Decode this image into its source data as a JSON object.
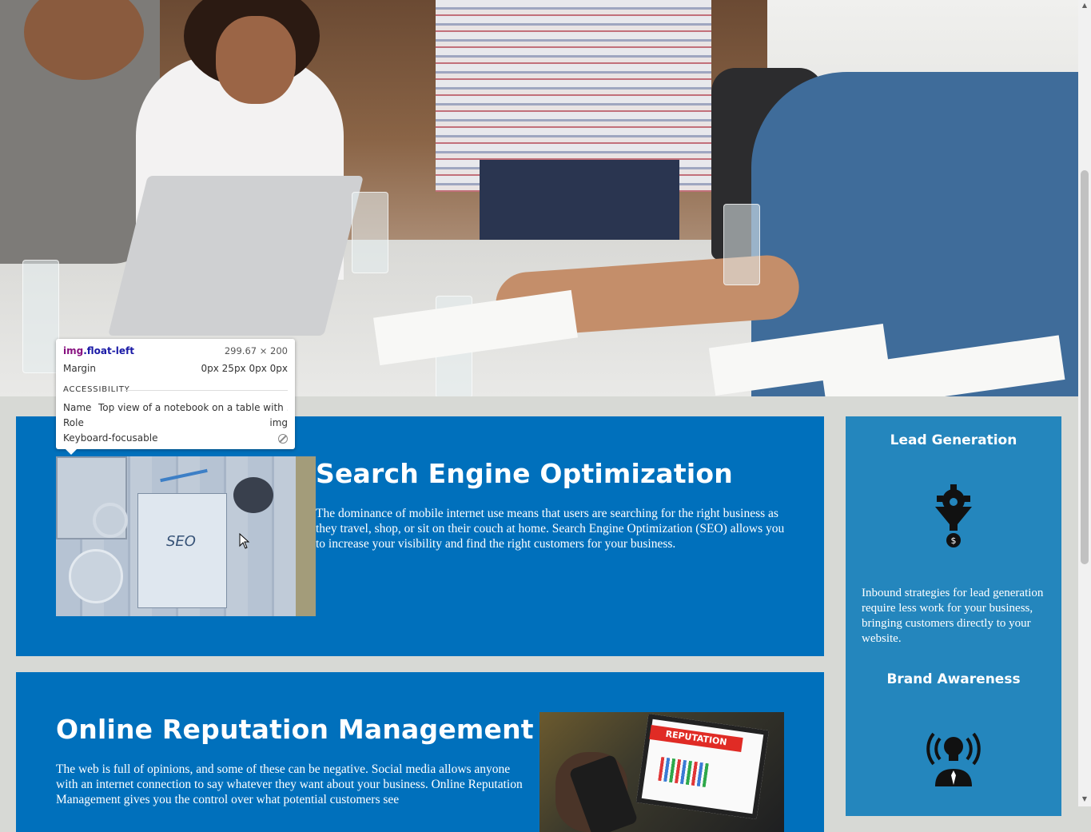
{
  "hero": {
    "image_alt": "Team meeting photo with people around a table"
  },
  "seo_card": {
    "title": "Search Engine Optimization",
    "body": "The dominance of mobile internet use means that users are searching for the right business as they travel, shop, or sit on their couch at home. Search Engine Optimization (SEO) allows you to increase your visibility and find the right customers for your business.",
    "image_word": "SEO"
  },
  "orm_card": {
    "title": "Online Reputation Management",
    "body": "The web is full of opinions, and some of these can be negative. Social media allows anyone with an internet connection to say whatever they want about your business. Online Reputation Management gives you the control over what potential customers see",
    "image_banner": "REPUTATION"
  },
  "sidebar": {
    "lead_title": "Lead Generation",
    "lead_body": "Inbound strategies for lead generation require less work for your business, bringing customers directly to your website.",
    "brand_title": "Brand Awareness"
  },
  "tooltip": {
    "tag": "img",
    "cls": ".float-left",
    "size": "299.67 × 200",
    "margin_label": "Margin",
    "margin_value": "0px 25px 0px 0px",
    "section": "ACCESSIBILITY",
    "name_label": "Name",
    "name_value": "Top view of a notebook on a table with ...",
    "role_label": "Role",
    "role_value": "img",
    "focus_label": "Keyboard-focusable"
  },
  "colors": {
    "card_blue": "#0070bc",
    "sidebar_blue": "#2486bd",
    "page_bg": "#d7d9d5"
  },
  "icons": [
    "funnel-dollar-icon",
    "lightbulb-broadcast-icon",
    "not-allowed-icon",
    "mouse-pointer-icon"
  ]
}
